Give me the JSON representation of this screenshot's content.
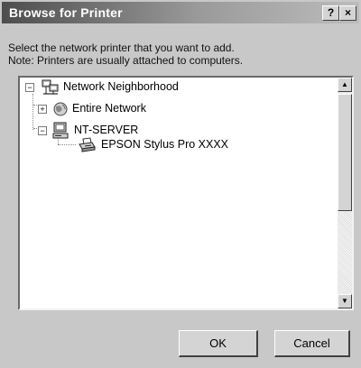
{
  "window": {
    "title": "Browse for Printer",
    "help_label": "?",
    "close_label": "×"
  },
  "description": {
    "line1": "Select the network printer that you want to add.",
    "line2": "Note: Printers are usually attached to computers."
  },
  "tree": {
    "items": [
      {
        "label": "Network Neighborhood",
        "expander": "⊟",
        "icon": "network-neighborhood-icon"
      },
      {
        "label": "Entire Network",
        "expander": "⊞",
        "icon": "globe-icon"
      },
      {
        "label": "NT-SERVER",
        "expander": "⊟",
        "icon": "computer-icon"
      },
      {
        "label": "EPSON Stylus Pro XXXX",
        "expander": "",
        "icon": "printer-icon"
      }
    ]
  },
  "buttons": {
    "ok": "OK",
    "cancel": "Cancel"
  }
}
